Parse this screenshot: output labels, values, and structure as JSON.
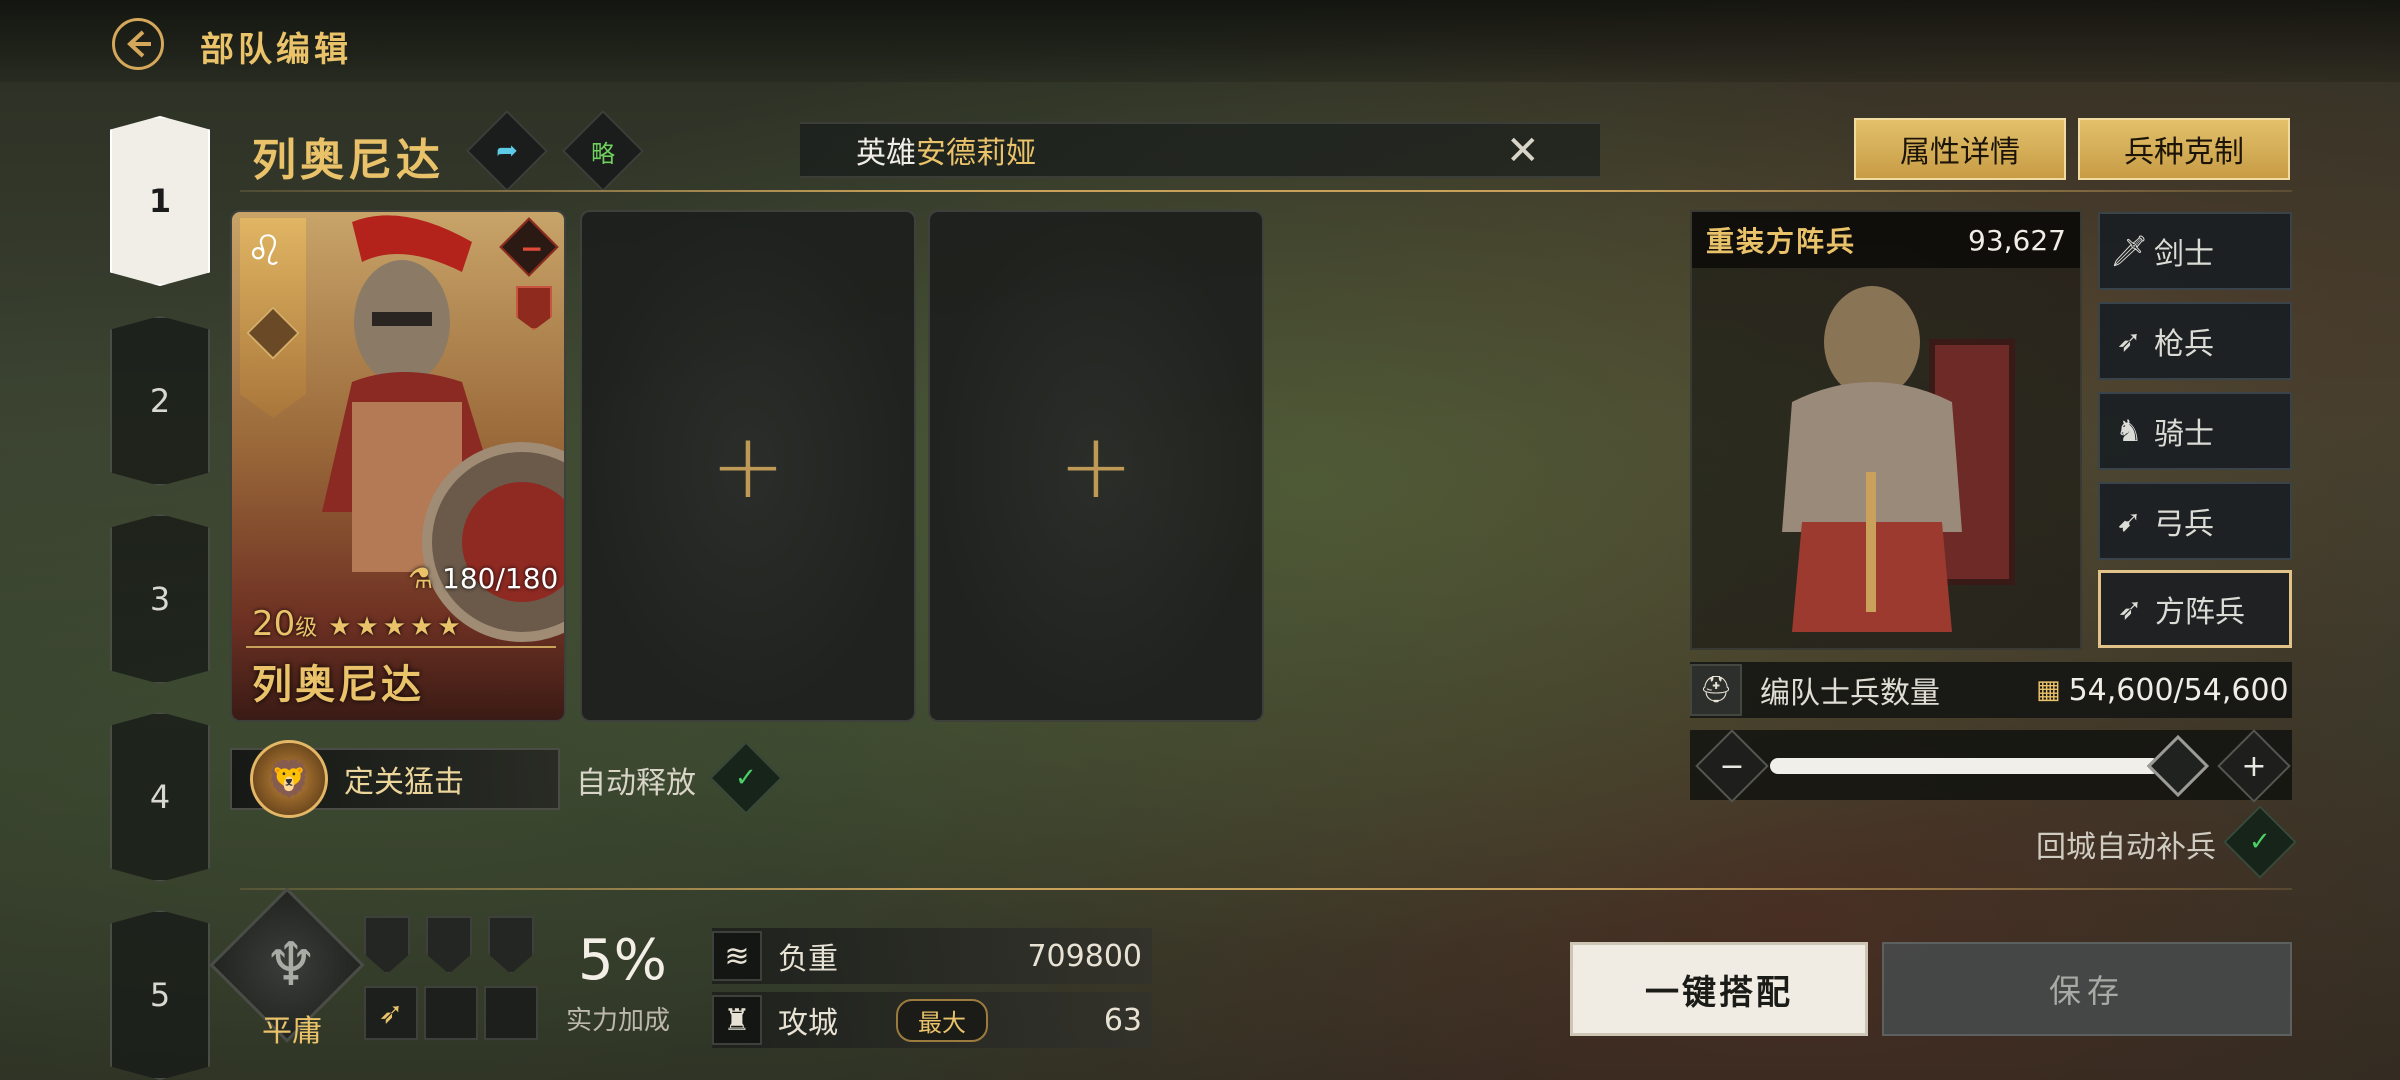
{
  "header": {
    "title": "部队编辑"
  },
  "slots": [
    "1",
    "2",
    "3",
    "4",
    "5"
  ],
  "hero": {
    "name": "列奥尼达",
    "strategy_label": "略",
    "level": "20",
    "level_unit": "级",
    "stars": "★★★★★",
    "stamina": "180/180",
    "card_name": "列奥尼达"
  },
  "search": {
    "prefix": "英雄",
    "value": "安德莉娅"
  },
  "top_buttons": {
    "attributes": "属性详情",
    "counter": "兵种克制"
  },
  "skill": {
    "name": "定关猛击",
    "auto_label": "自动释放"
  },
  "unit": {
    "name": "重装方阵兵",
    "count": "93,627"
  },
  "unit_types": [
    {
      "label": "剑士",
      "selected": false
    },
    {
      "label": "枪兵",
      "selected": false
    },
    {
      "label": "骑士",
      "selected": false
    },
    {
      "label": "弓兵",
      "selected": false
    },
    {
      "label": "方阵兵",
      "selected": true
    }
  ],
  "soldiers": {
    "label": "编队士兵数量",
    "value": "54,600/54,600",
    "slider_fraction": 1.0
  },
  "refill": {
    "label": "回城自动补兵"
  },
  "formation": {
    "label": "平庸"
  },
  "power": {
    "value": "5%",
    "label": "实力加成"
  },
  "stats": {
    "load_label": "负重",
    "load_value": "709800",
    "siege_label": "攻城",
    "siege_badge": "最大",
    "siege_value": "63"
  },
  "actions": {
    "auto_equip": "一键搭配",
    "save": "保存"
  },
  "colors": {
    "gold": "#e9c26a",
    "check": "#4ccf66"
  }
}
